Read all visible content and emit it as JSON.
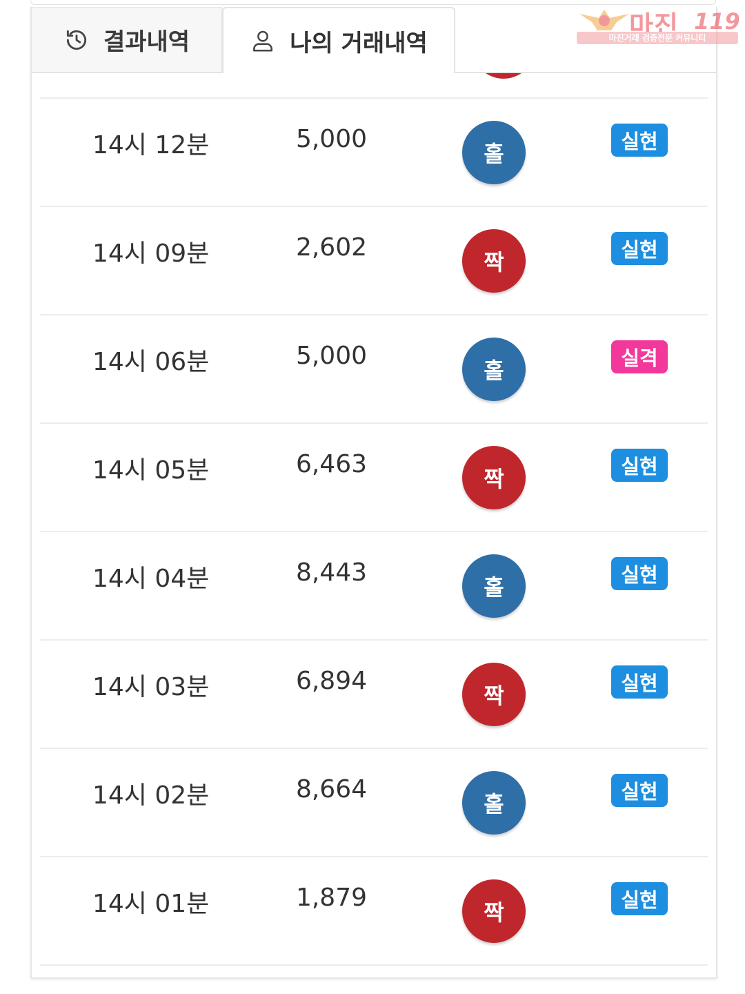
{
  "tabs": [
    {
      "label": "결과내역",
      "icon": "history-icon",
      "active": false
    },
    {
      "label": "나의 거래내역",
      "icon": "user-icon",
      "active": true
    }
  ],
  "watermark": {
    "title": "마진",
    "number": "119",
    "subtitle": "마진거래 검증전문 커뮤니티"
  },
  "colors": {
    "odd_ball": "#2f6fa8",
    "even_ball": "#c0272d",
    "hit_badge": "#1e8fe0",
    "miss_badge": "#f2389a"
  },
  "trades": [
    {
      "time": "14시 12분",
      "amount": "5,000",
      "pick": "홀",
      "result": "실현"
    },
    {
      "time": "14시 09분",
      "amount": "2,602",
      "pick": "짝",
      "result": "실현"
    },
    {
      "time": "14시 06분",
      "amount": "5,000",
      "pick": "홀",
      "result": "실격"
    },
    {
      "time": "14시 05분",
      "amount": "6,463",
      "pick": "짝",
      "result": "실현"
    },
    {
      "time": "14시 04분",
      "amount": "8,443",
      "pick": "홀",
      "result": "실현"
    },
    {
      "time": "14시 03분",
      "amount": "6,894",
      "pick": "짝",
      "result": "실현"
    },
    {
      "time": "14시 02분",
      "amount": "8,664",
      "pick": "홀",
      "result": "실현"
    },
    {
      "time": "14시 01분",
      "amount": "1,879",
      "pick": "짝",
      "result": "실현"
    }
  ]
}
